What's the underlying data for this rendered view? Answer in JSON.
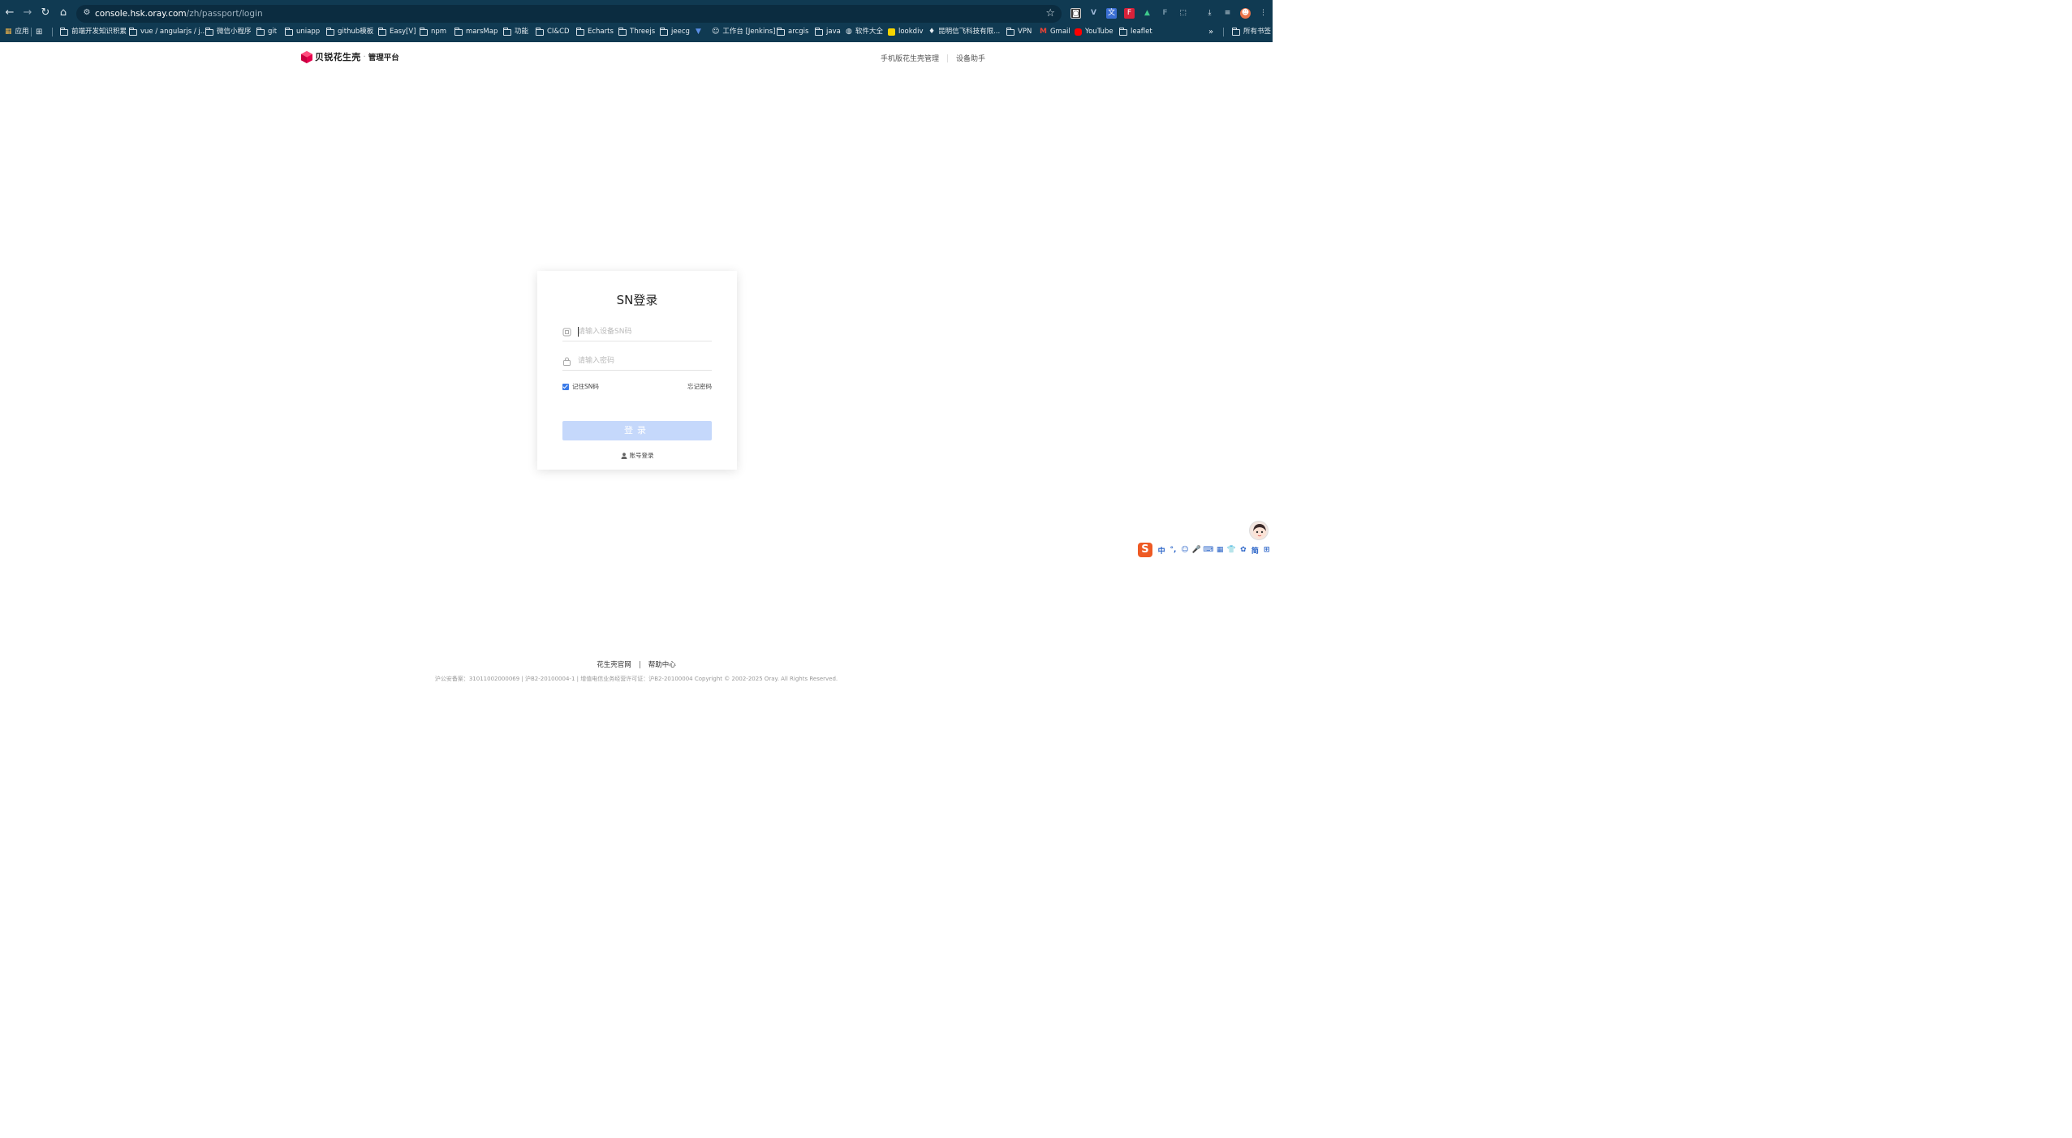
{
  "browser": {
    "url_host": "console.hsk.oray.com",
    "url_path": "/zh/passport/login",
    "bookmarks": [
      {
        "label": "应用",
        "kind": "apps"
      },
      {
        "label": "",
        "kind": "grid"
      },
      {
        "label": "前端开发知识积累",
        "kind": "folder"
      },
      {
        "label": "vue / angularjs / j...",
        "kind": "folder"
      },
      {
        "label": "微信小程序",
        "kind": "folder"
      },
      {
        "label": "git",
        "kind": "folder"
      },
      {
        "label": "uniapp",
        "kind": "folder"
      },
      {
        "label": "github模板",
        "kind": "folder"
      },
      {
        "label": "Easy[V]",
        "kind": "folder"
      },
      {
        "label": "npm",
        "kind": "folder"
      },
      {
        "label": "marsMap",
        "kind": "folder"
      },
      {
        "label": "功能",
        "kind": "folder"
      },
      {
        "label": "CI&CD",
        "kind": "folder"
      },
      {
        "label": "Echarts",
        "kind": "folder"
      },
      {
        "label": "Threejs",
        "kind": "folder"
      },
      {
        "label": "jeecg",
        "kind": "folder"
      },
      {
        "label": "",
        "kind": "vuetify"
      },
      {
        "label": "工作台 [Jenkins]",
        "kind": "jenkins"
      },
      {
        "label": "arcgis",
        "kind": "folder"
      },
      {
        "label": "java",
        "kind": "folder"
      },
      {
        "label": "软件大全",
        "kind": "globe"
      },
      {
        "label": "lookdiv",
        "kind": "lookdiv"
      },
      {
        "label": "昆明信飞科技有限...",
        "kind": "company"
      },
      {
        "label": "VPN",
        "kind": "folder"
      },
      {
        "label": "Gmail",
        "kind": "gmail"
      },
      {
        "label": "YouTube",
        "kind": "youtube"
      },
      {
        "label": "leaflet",
        "kind": "folder"
      }
    ],
    "all_bookmarks": "所有书签"
  },
  "header": {
    "brand": "贝锐花生壳",
    "platform": "管理平台",
    "links": [
      "手机版花生壳管理",
      "设备助手"
    ]
  },
  "login": {
    "title": "SN登录",
    "sn_placeholder": "请输入设备SN码",
    "password_placeholder": "请输入密码",
    "remember_label": "记住SN码",
    "remember_checked": true,
    "forgot_label": "忘记密码",
    "submit_label": "登录",
    "account_login_label": "账号登录"
  },
  "footer": {
    "links": [
      "花生壳官网",
      "帮助中心"
    ],
    "legal": "沪公安备案：31011002000069 | 沪B2-20100004-1 | 增值电信业务经营许可证：沪B2-20100004 Copyright © 2002-2025 Oray. All Rights Reserved."
  },
  "ime": {
    "items": [
      "中",
      "°,",
      "☺",
      "🎤",
      "⌨",
      "▦",
      "👕",
      "✿",
      "简",
      "⊞"
    ]
  },
  "colors": {
    "browser_bg": "#103a52",
    "brand_pink": "#e6004c",
    "primary_disabled": "#c5d8fb",
    "checkbox": "#3a7be8"
  }
}
